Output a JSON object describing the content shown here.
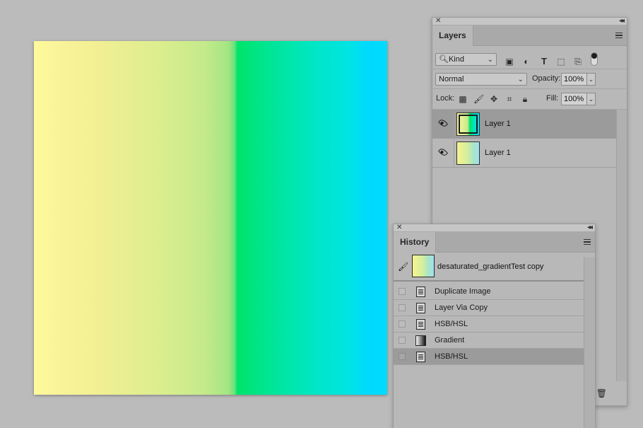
{
  "layers_panel": {
    "tab_label": "Layers",
    "kind_filter": "Kind",
    "blend_mode": "Normal",
    "opacity_label": "Opacity:",
    "opacity_value": "100%",
    "lock_label": "Lock:",
    "fill_label": "Fill:",
    "fill_value": "100%",
    "layers": [
      {
        "name": "Layer 1",
        "visible": true,
        "selected": true
      },
      {
        "name": "Layer 1",
        "visible": true,
        "selected": false
      }
    ]
  },
  "history_panel": {
    "tab_label": "History",
    "snapshot_name": "desaturated_gradientTest copy",
    "items": [
      {
        "label": "Duplicate Image",
        "icon": "document-icon",
        "selected": false
      },
      {
        "label": "Layer Via Copy",
        "icon": "document-icon",
        "selected": false
      },
      {
        "label": "HSB/HSL",
        "icon": "document-icon",
        "selected": false
      },
      {
        "label": "Gradient",
        "icon": "gradient-icon",
        "selected": false
      },
      {
        "label": "HSB/HSL",
        "icon": "document-icon",
        "selected": true
      }
    ]
  },
  "colors": {
    "background": "#bbbbbb",
    "panel": "#b8b8b8",
    "selected_row": "#9b9b9b",
    "gradient_start": "#fdf79d",
    "gradient_green": "#00e46a",
    "gradient_end": "#00dbff"
  }
}
